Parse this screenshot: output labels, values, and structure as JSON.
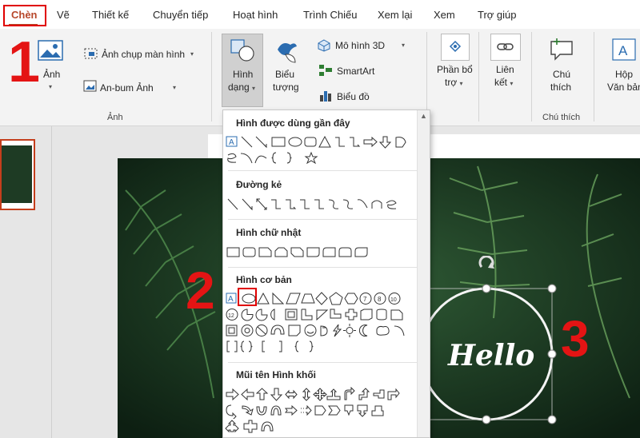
{
  "tabs": [
    {
      "label": "Chèn",
      "active": true
    },
    {
      "label": "Vẽ"
    },
    {
      "label": "Thiết kế"
    },
    {
      "label": "Chuyển tiếp"
    },
    {
      "label": "Hoạt hình"
    },
    {
      "label": "Trình Chiếu"
    },
    {
      "label": "Xem lại"
    },
    {
      "label": "Xem"
    },
    {
      "label": "Trợ giúp"
    }
  ],
  "ribbon": {
    "anh": "Ảnh",
    "anh_chup": "Ảnh chụp màn hình",
    "an_bum": "An-bum Ảnh",
    "group_anh": "Ảnh",
    "hinh": "Hình",
    "dang": "dạng",
    "bieu": "Biểu",
    "tuong": "tượng",
    "mo_hinh_3d": "Mô hình 3D",
    "smartart": "SmartArt",
    "bieu_do": "Biểu đồ",
    "phan_bo": "Phần bổ",
    "tro": "trợ",
    "lien": "Liên",
    "ket": "kết",
    "chu": "Chú",
    "thich": "thích",
    "group_chu_thich": "Chú thích",
    "hop": "Hộp",
    "van_ban": "Văn bản"
  },
  "menu": {
    "recent": "Hình được dùng gần đây",
    "lines": "Đường kẻ",
    "rectangles": "Hình chữ nhật",
    "basic": "Hình cơ bản",
    "arrows": "Mũi tên Hình khối"
  },
  "annotations": {
    "one": "1",
    "two": "2",
    "three": "3"
  },
  "slide": {
    "text": "Hello"
  },
  "colors": {
    "accent": "#b7472a",
    "annotation": "#e41414"
  }
}
